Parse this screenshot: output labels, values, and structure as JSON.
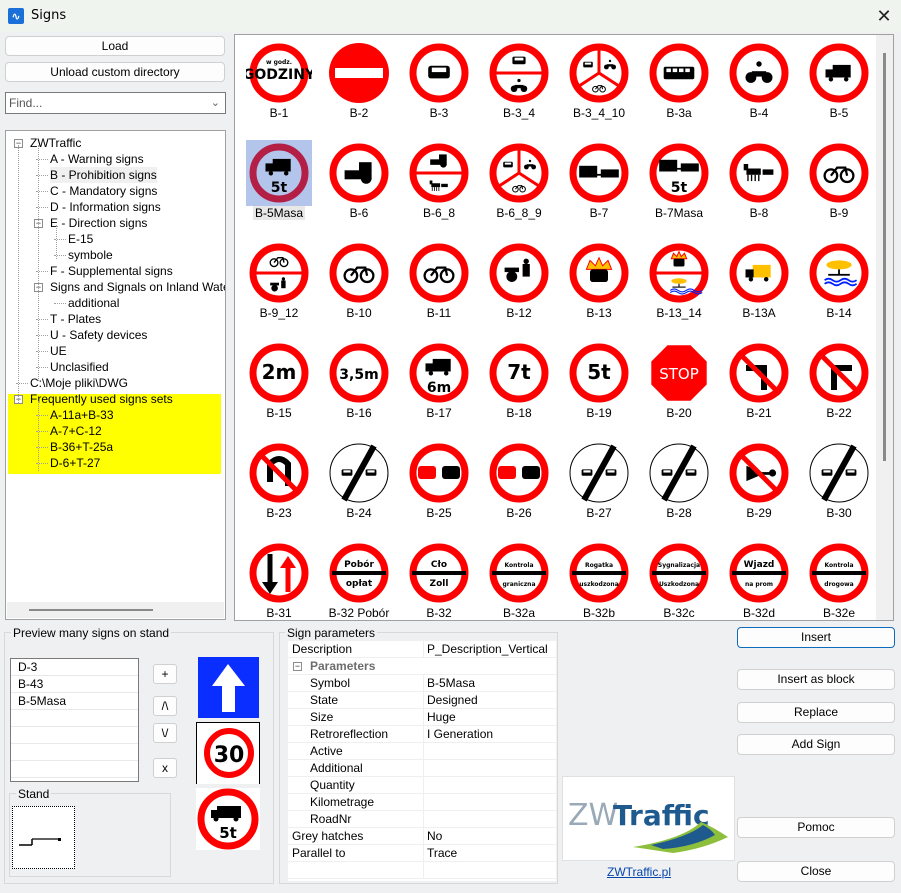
{
  "window": {
    "title": "Signs",
    "app_icon": "zwtraffic-app-icon",
    "close_glyph": "✕"
  },
  "left_panel": {
    "load_label": "Load",
    "unload_label": "Unload custom directory",
    "find_placeholder": "Find...",
    "tree": [
      {
        "label": "ZWTraffic",
        "level": 0,
        "expander": "⊟"
      },
      {
        "label": "A - Warning signs",
        "level": 1
      },
      {
        "label": "B - Prohibition signs",
        "level": 1,
        "selected": true
      },
      {
        "label": "C - Mandatory signs",
        "level": 1
      },
      {
        "label": "D - Information signs",
        "level": 1
      },
      {
        "label": "E - Direction signs",
        "level": 1,
        "expander": "⊟"
      },
      {
        "label": "E-15",
        "level": 2
      },
      {
        "label": "symbole",
        "level": 2
      },
      {
        "label": "F - Supplemental signs",
        "level": 1
      },
      {
        "label": "Signs and Signals on Inland Waterways",
        "level": 1,
        "expander": "⊟"
      },
      {
        "label": "additional",
        "level": 2
      },
      {
        "label": "T - Plates",
        "level": 1
      },
      {
        "label": "U - Safety devices",
        "level": 1
      },
      {
        "label": "UE",
        "level": 1
      },
      {
        "label": "Unclasified",
        "level": 1
      },
      {
        "label": "C:\\Moje pliki\\DWG",
        "level": 0
      },
      {
        "label": "Frequently used signs sets",
        "level": 0,
        "expander": "⊟",
        "highlight": true
      },
      {
        "label": "A-11a+B-33",
        "level": 1,
        "highlight": true
      },
      {
        "label": "A-7+C-12",
        "level": 1,
        "highlight": true
      },
      {
        "label": "B-36+T-25a",
        "level": 1,
        "highlight": true
      },
      {
        "label": "D-6+T-27",
        "level": 1,
        "highlight": true
      }
    ]
  },
  "signs_grid": {
    "selected": "B-5Masa",
    "items": [
      {
        "label": "B-1",
        "kind": "text",
        "text": "GODZINY",
        "small": "w godz."
      },
      {
        "label": "B-2",
        "kind": "noentry"
      },
      {
        "label": "B-3",
        "kind": "car"
      },
      {
        "label": "B-3_4",
        "kind": "split2",
        "top": "car",
        "bottom": "moto"
      },
      {
        "label": "B-3_4_10",
        "kind": "split3"
      },
      {
        "label": "B-3a",
        "kind": "bus"
      },
      {
        "label": "B-4",
        "kind": "moto"
      },
      {
        "label": "B-5",
        "kind": "truck"
      },
      {
        "label": "B-5Masa",
        "kind": "truck",
        "text": "5t"
      },
      {
        "label": "B-6",
        "kind": "tractor"
      },
      {
        "label": "B-6_8",
        "kind": "split2",
        "top": "tractor",
        "bottom": "horse"
      },
      {
        "label": "B-6_8_9",
        "kind": "split3"
      },
      {
        "label": "B-7",
        "kind": "trailer"
      },
      {
        "label": "B-7Masa",
        "kind": "trailer",
        "text": "5t"
      },
      {
        "label": "B-8",
        "kind": "horse"
      },
      {
        "label": "B-9",
        "kind": "bike"
      },
      {
        "label": "B-9_12",
        "kind": "split2",
        "top": "bike",
        "bottom": "cart"
      },
      {
        "label": "B-10",
        "kind": "bike"
      },
      {
        "label": "B-11",
        "kind": "bike"
      },
      {
        "label": "B-12",
        "kind": "cart"
      },
      {
        "label": "B-13",
        "kind": "fire"
      },
      {
        "label": "B-13_14",
        "kind": "split2",
        "top": "fire",
        "bottom": "water"
      },
      {
        "label": "B-13A",
        "kind": "yellowtruck"
      },
      {
        "label": "B-14",
        "kind": "water"
      },
      {
        "label": "B-15",
        "kind": "text",
        "text": "2m"
      },
      {
        "label": "B-16",
        "kind": "text",
        "text": "3,5m"
      },
      {
        "label": "B-17",
        "kind": "truck",
        "text": "6m"
      },
      {
        "label": "B-18",
        "kind": "text",
        "text": "7t"
      },
      {
        "label": "B-19",
        "kind": "text",
        "text": "5t"
      },
      {
        "label": "B-20",
        "kind": "stop",
        "text": "STOP"
      },
      {
        "label": "B-21",
        "kind": "turnleft"
      },
      {
        "label": "B-22",
        "kind": "turnright"
      },
      {
        "label": "B-23",
        "kind": "uturn"
      },
      {
        "label": "B-24",
        "kind": "end"
      },
      {
        "label": "B-25",
        "kind": "overtake"
      },
      {
        "label": "B-26",
        "kind": "overtake"
      },
      {
        "label": "B-27",
        "kind": "end"
      },
      {
        "label": "B-28",
        "kind": "end"
      },
      {
        "label": "B-29",
        "kind": "horn"
      },
      {
        "label": "B-30",
        "kind": "end"
      },
      {
        "label": "B-31",
        "kind": "priority"
      },
      {
        "label": "B-32 Pobór",
        "kind": "bar",
        "top": "Pobór",
        "bottom": "opłat"
      },
      {
        "label": "B-32",
        "kind": "bar",
        "top": "Cło",
        "bottom": "Zoll"
      },
      {
        "label": "B-32a",
        "kind": "bar",
        "top": "Kontrola",
        "bottom": "graniczna"
      },
      {
        "label": "B-32b",
        "kind": "bar",
        "top": "Rogatka",
        "bottom": "uszkodzona"
      },
      {
        "label": "B-32c",
        "kind": "bar",
        "top": "Sygnalizacja",
        "bottom": "Uszkodzona"
      },
      {
        "label": "B-32d",
        "kind": "bar",
        "top": "Wjazd",
        "bottom": "na prom"
      },
      {
        "label": "B-32e",
        "kind": "bar",
        "top": "Kontrola",
        "bottom": "drogowa"
      }
    ]
  },
  "stand_preview": {
    "group_title": "Preview many signs on stand",
    "list": [
      "D-3",
      "B-43",
      "B-5Masa",
      "",
      "",
      "",
      ""
    ],
    "buttons": {
      "add": "+",
      "up": "/\\",
      "down": "\\/",
      "remove": "x"
    },
    "stand_title": "Stand",
    "preview_signs": [
      "D-3",
      "B-43",
      "B-5Masa"
    ],
    "speed_limit": "30",
    "mass_limit": "5t"
  },
  "sign_parameters": {
    "group_title": "Sign parameters",
    "rows": [
      {
        "name": "Description",
        "value": "P_Description_Vertical",
        "indent": 0
      },
      {
        "name": "Parameters",
        "value": "",
        "category": true,
        "expander": "⊟"
      },
      {
        "name": "Symbol",
        "value": "B-5Masa",
        "indent": 1
      },
      {
        "name": "State",
        "value": "Designed",
        "indent": 1
      },
      {
        "name": "Size",
        "value": "Huge",
        "indent": 1
      },
      {
        "name": "Retroreflection",
        "value": "I Generation",
        "indent": 1
      },
      {
        "name": "Active",
        "value": "",
        "indent": 1
      },
      {
        "name": "Additional",
        "value": "",
        "indent": 1
      },
      {
        "name": "Quantity",
        "value": "",
        "indent": 1
      },
      {
        "name": "Kilometrage",
        "value": "",
        "indent": 1
      },
      {
        "name": "RoadNr",
        "value": "",
        "indent": 1
      },
      {
        "name": "Grey hatches",
        "value": "No",
        "indent": 0
      },
      {
        "name": "Parallel to",
        "value": "Trace",
        "indent": 0
      },
      {
        "name": "",
        "value": "",
        "indent": 0
      }
    ]
  },
  "actions": {
    "insert": "Insert",
    "insert_block": "Insert as block",
    "replace": "Replace",
    "add_sign": "Add Sign",
    "help": "Pomoc",
    "close": "Close"
  },
  "branding": {
    "logo_light": "ZW",
    "logo_bold": "Traffic",
    "link": "ZWTraffic.pl"
  },
  "colors": {
    "sign_red": "#ff0000",
    "tree_highlight": "#ffff00",
    "primary_border": "#0f6cbd",
    "logo_blue": "#1f5a8e",
    "logo_green": "#8dbf3c",
    "d3_blue": "#0a2eff"
  }
}
